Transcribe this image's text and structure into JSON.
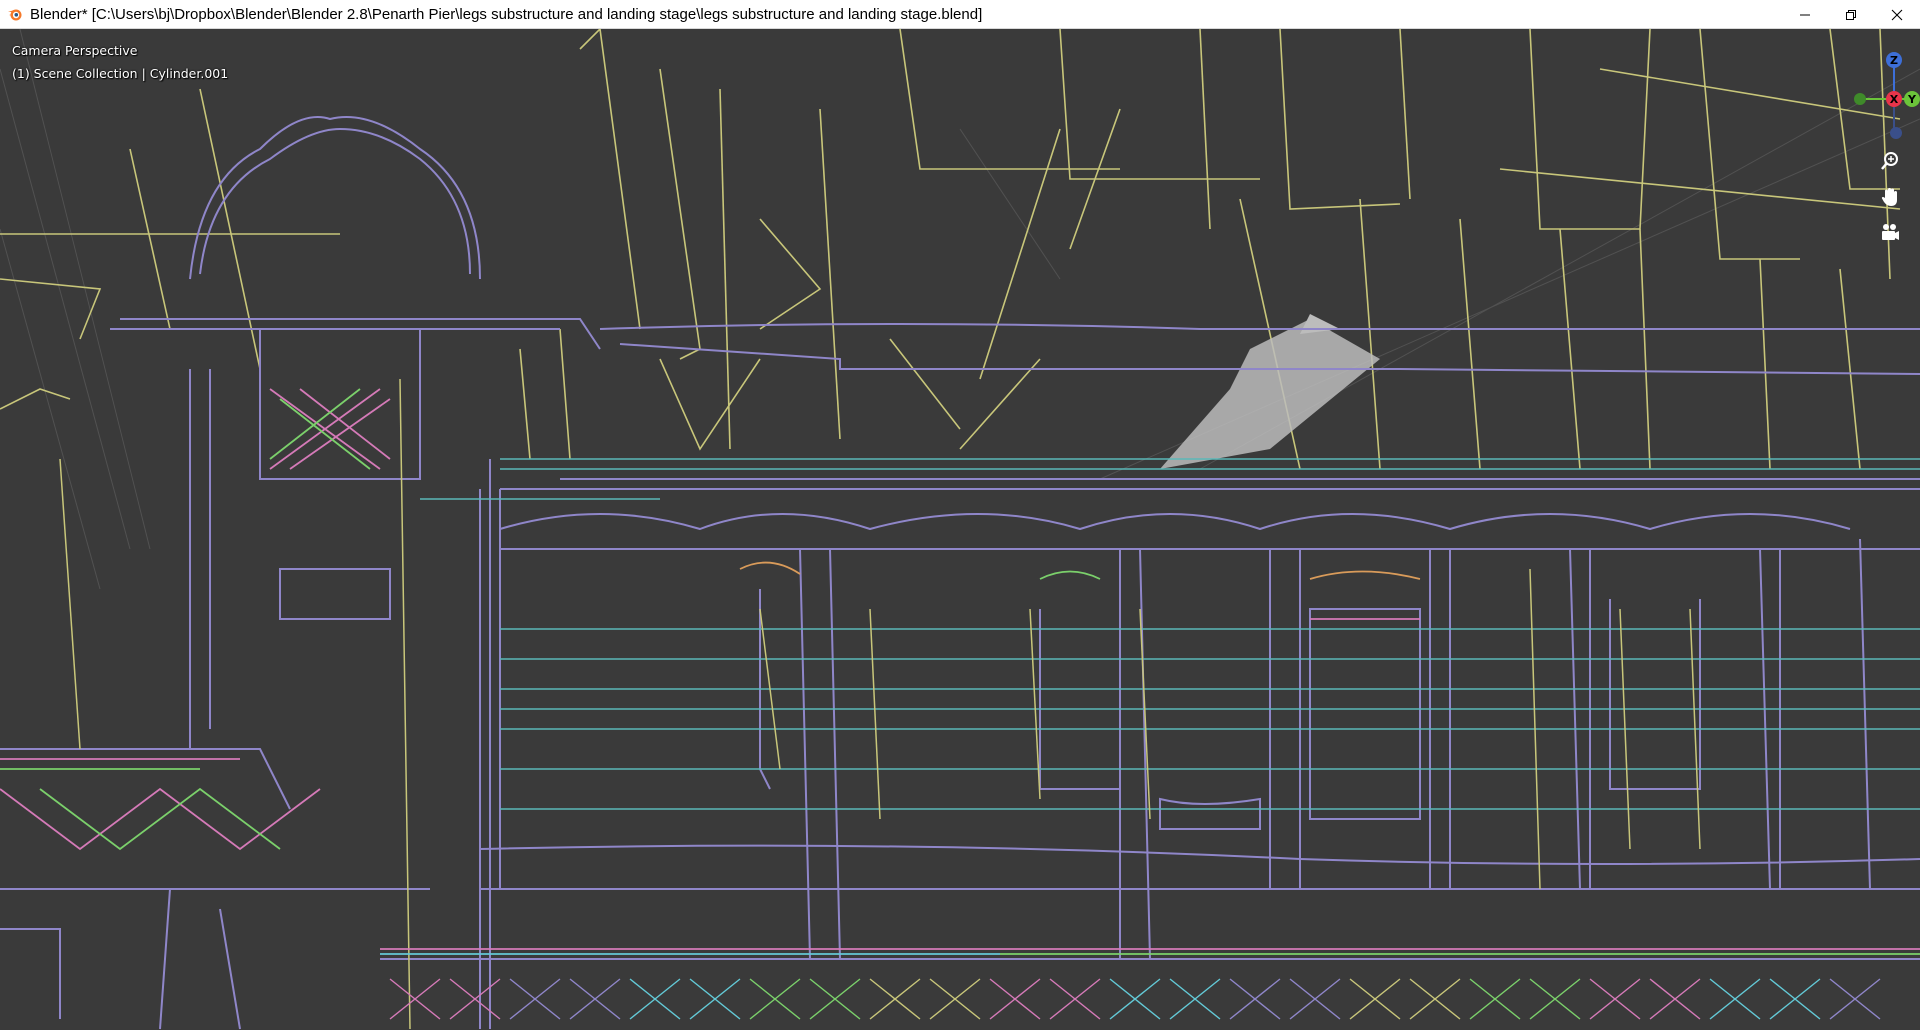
{
  "window": {
    "title": "Blender* [C:\\Users\\bj\\Dropbox\\Blender\\Blender 2.8\\Penarth Pier\\legs substructure and landing stage\\legs substructure and landing stage.blend]",
    "app_icon": "blender-logo-icon",
    "controls": [
      "minimize-icon",
      "restore-icon",
      "close-icon"
    ]
  },
  "viewport": {
    "view_name": "Camera Perspective",
    "collection_info": "(1) Scene Collection | Cylinder.001",
    "background_color": "#3a3a3a"
  },
  "gizmo": {
    "axis_z": "Z",
    "axis_x": "X",
    "axis_y": "Y",
    "colors": {
      "x": "#e8344a",
      "y": "#6bc43a",
      "z": "#3d6fd8",
      "neg_x": "#7a2a33",
      "neg_y": "#3f8a2a",
      "neg_z": "#3a4f8a"
    }
  },
  "tools": [
    {
      "name": "zoom-icon"
    },
    {
      "name": "pan-hand-icon"
    },
    {
      "name": "camera-view-icon"
    }
  ],
  "line_colors": {
    "lavender": "#8f86c9",
    "olive": "#c8c67a",
    "teal": "#5ab8b8",
    "cyan": "#63c9d6",
    "pink": "#d57ab8",
    "green": "#7bd06b",
    "orange": "#d99b5a",
    "grey_fill": "#bcbcbc"
  }
}
